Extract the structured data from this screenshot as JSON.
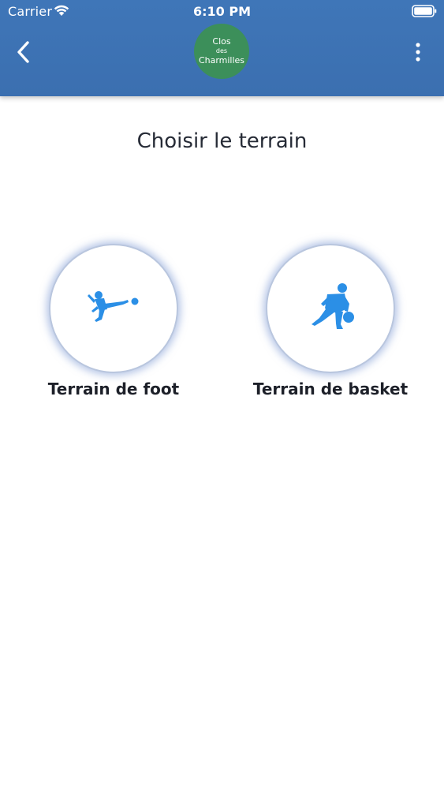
{
  "status_bar": {
    "carrier": "Carrier",
    "time": "6:10 PM",
    "icons": [
      "wifi-icon",
      "battery-icon"
    ]
  },
  "nav": {
    "back_icon": "chevron-left-icon",
    "more_icon": "more-vertical-icon",
    "logo": {
      "line1": "Clos",
      "line2": "des",
      "line3": "Charmilles",
      "color": "#3c8f5a"
    },
    "background": "#3b6fb0"
  },
  "page": {
    "title": "Choisir le terrain"
  },
  "fields": [
    {
      "label": "Terrain de foot",
      "icon": "soccer-player-icon"
    },
    {
      "label": "Terrain de basket",
      "icon": "basketball-player-icon"
    }
  ],
  "colors": {
    "accent": "#2b8fe6",
    "header": "#3b6fb0",
    "text": "#1d2029"
  }
}
